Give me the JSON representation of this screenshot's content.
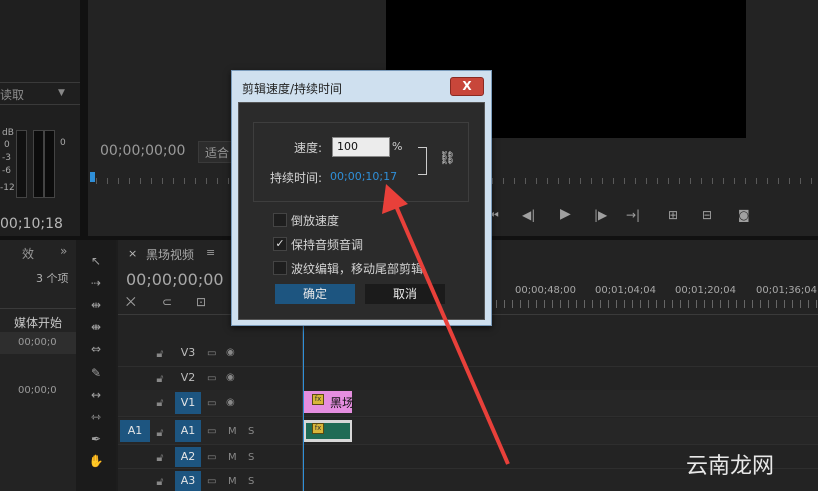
{
  "source_monitor": {
    "read_label": "读取",
    "db_label": "dB",
    "meter_ticks": [
      "0",
      "-3",
      "-6",
      "-12"
    ],
    "meter_right_tick": "0",
    "timecode": "00;00;00;00",
    "fit_label": "适合"
  },
  "project_panel": {
    "timecode": "00;10;18",
    "tab_label": "效",
    "items_count": "3 个项",
    "column_media_start": "媒体开始",
    "row1_value": "00;00;0",
    "row2_value": "00;00;0"
  },
  "timeline": {
    "tab_label": "黑场视频",
    "timecode": "00;00;00;00",
    "ruler_ticks": [
      "00;00;48;00",
      "00;01;04;04",
      "00;01;20;04",
      "00;01;36;04"
    ],
    "tracks": [
      {
        "name": "V3",
        "highlight": false
      },
      {
        "name": "V2",
        "highlight": false
      },
      {
        "name": "V1",
        "highlight": true
      },
      {
        "name": "A1",
        "highlight": true
      },
      {
        "name": "A2",
        "highlight": true
      },
      {
        "name": "A3",
        "highlight": true
      }
    ],
    "source_patch": "A1",
    "clip_video_label": "黑场",
    "mute_label": "M",
    "solo_label": "S"
  },
  "dialog": {
    "title": "剪辑速度/持续时间",
    "close_label": "X",
    "speed_label": "速度:",
    "speed_value": "100",
    "speed_unit": "%",
    "duration_label": "持续时间:",
    "duration_value": "00;00;10;17",
    "reverse_label": "倒放速度",
    "reverse_checked": false,
    "maintain_pitch_label": "保持音频音调",
    "maintain_pitch_checked": true,
    "ripple_label": "波纹编辑，移动尾部剪辑",
    "ripple_checked": false,
    "ok_label": "确定",
    "cancel_label": "取消"
  },
  "watermark": "云南龙网",
  "colors": {
    "accent_blue": "#1d5580",
    "timecode_blue": "#2f8fd8",
    "annotation_red": "#e8403a",
    "clip_pink": "#e58ee0",
    "clip_green": "#1f6b55"
  }
}
